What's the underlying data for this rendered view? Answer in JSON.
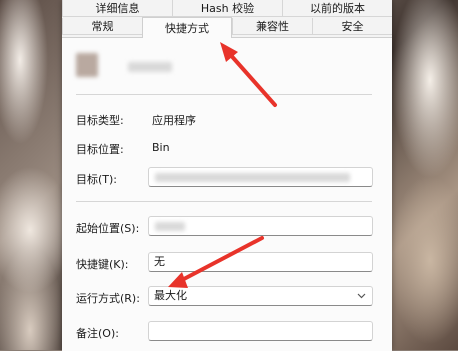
{
  "tabs_row1": [
    "详细信息",
    "Hash 校验",
    "以前的版本"
  ],
  "tabs_row2": [
    "常规",
    "快捷方式",
    "兼容性",
    "安全"
  ],
  "active_tab": "快捷方式",
  "fields": {
    "target_type_label": "目标类型:",
    "target_type_value": "应用程序",
    "target_location_label": "目标位置:",
    "target_location_value": "Bin",
    "target_label": "目标(T):",
    "start_in_label": "起始位置(S):",
    "shortcut_key_label": "快捷键(K):",
    "shortcut_key_value": "无",
    "run_label": "运行方式(R):",
    "run_value": "最大化",
    "comment_label": "备注(O):"
  },
  "colors": {
    "arrow": "#e8332a",
    "dialog_bg": "#f3f3f3",
    "panel_bg": "#fbfbfb"
  }
}
